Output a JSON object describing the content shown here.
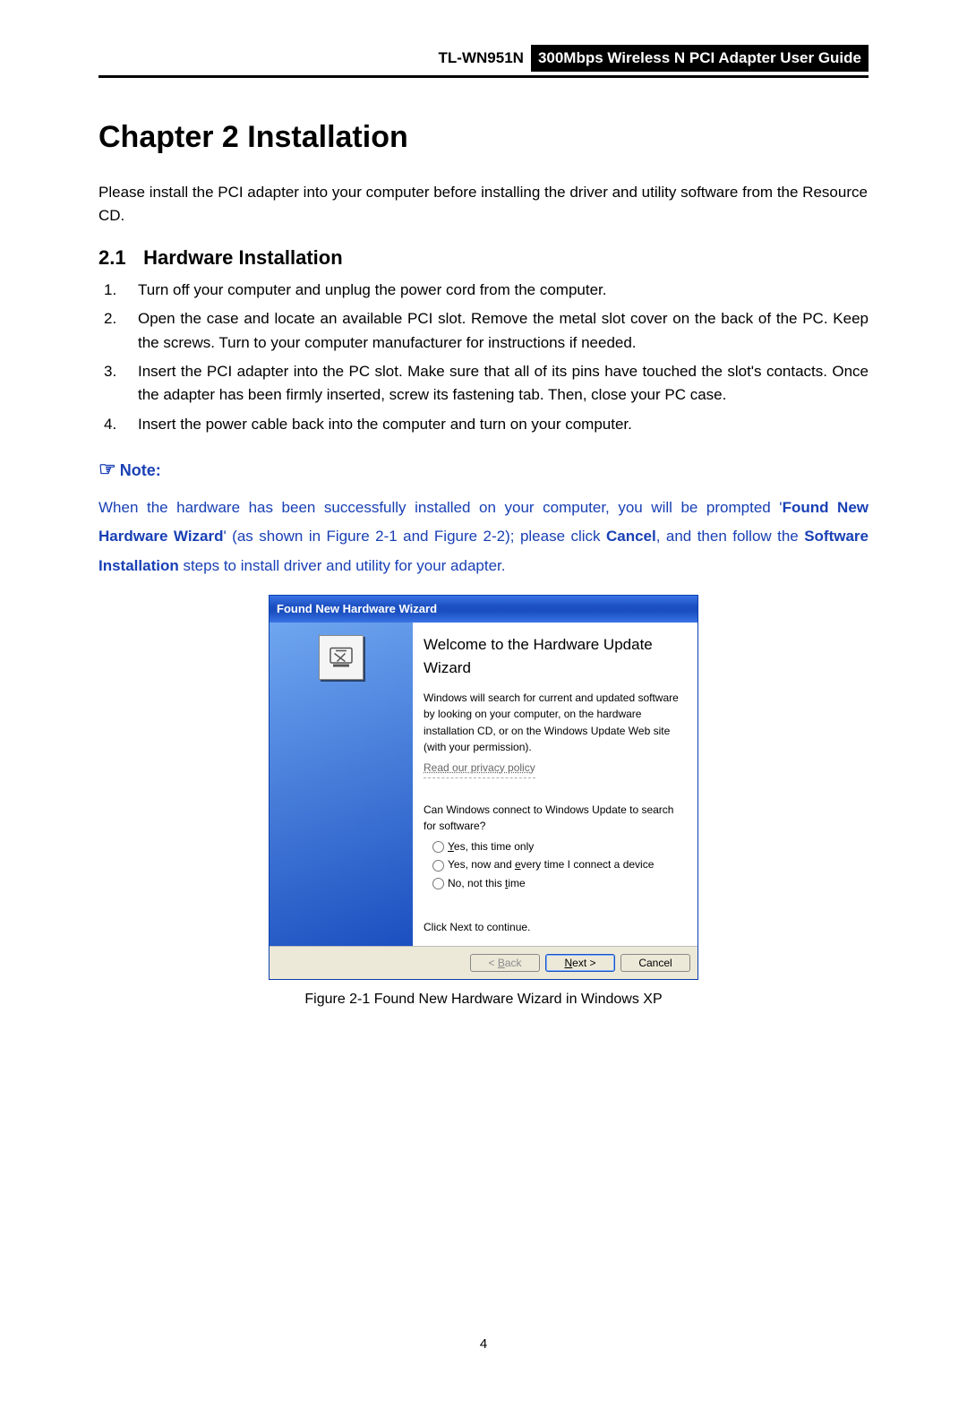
{
  "header": {
    "model": "TL-WN951N",
    "title": "300Mbps Wireless N PCI Adapter User Guide"
  },
  "chapter": {
    "title": "Chapter 2  Installation"
  },
  "intro": "Please install the PCI adapter into your computer before installing the driver and utility software from the Resource CD.",
  "section": {
    "number": "2.1",
    "title": "Hardware Installation"
  },
  "steps": [
    {
      "n": "1.",
      "text": "Turn off your computer and unplug the power cord from the computer."
    },
    {
      "n": "2.",
      "text": "Open the case and locate an available PCI slot. Remove the metal slot cover on the back of the PC. Keep the screws. Turn to your computer manufacturer for instructions if needed."
    },
    {
      "n": "3.",
      "text": "Insert the PCI adapter into the PC slot. Make sure that all of its pins have touched the slot's contacts. Once the adapter has been firmly inserted, screw its fastening tab. Then, close your PC case."
    },
    {
      "n": "4.",
      "text": "Insert the power cable back into the computer and turn on your computer."
    }
  ],
  "note": {
    "heading": "Note:",
    "p1": "When the hardware has been successfully installed on your computer, you will be prompted '",
    "bold1": "Found New Hardware Wizard",
    "p2": "' (as shown in Figure 2-1 and Figure 2-2); please click ",
    "bold2": "Cancel",
    "p3": ", and then follow the ",
    "bold3": "Software Installation",
    "p4": " steps to install driver and utility for your adapter."
  },
  "dialog": {
    "titlebar": "Found New Hardware Wizard",
    "heading": "Welcome to the Hardware Update Wizard",
    "desc": "Windows will search for current and updated software by looking on your computer, on the hardware installation CD, or on the Windows Update Web site (with your permission).",
    "privacy": "Read our privacy policy",
    "question": "Can Windows connect to Windows Update to search for software?",
    "radios": {
      "r1_pre": "",
      "r1_u": "Y",
      "r1_post": "es, this time only",
      "r2_pre": "Yes, now and ",
      "r2_u": "e",
      "r2_post": "very time I connect a device",
      "r3_pre": "No, not this ",
      "r3_u": "t",
      "r3_post": "ime"
    },
    "continue": "Click Next to continue.",
    "buttons": {
      "back_pre": "< ",
      "back_u": "B",
      "back_post": "ack",
      "next_u": "N",
      "next_post": "ext >",
      "cancel": "Cancel"
    }
  },
  "caption": "Figure 2-1 Found New Hardware Wizard in Windows XP",
  "page_number": "4"
}
